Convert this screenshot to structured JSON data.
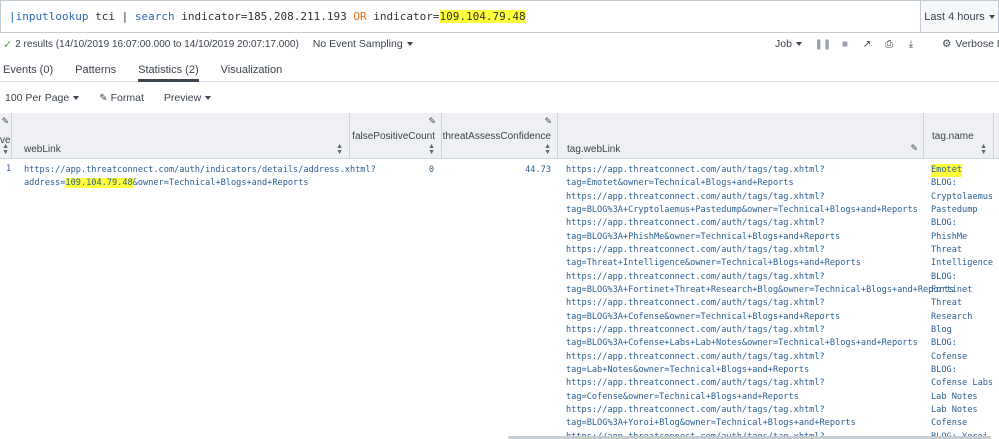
{
  "search": {
    "pipe": "|",
    "cmd1": "inputlookup",
    "arg1": " tci | ",
    "cmd2": "search",
    "arg2": " indicator=185.208.211.193 ",
    "op": "OR",
    "arg3": " indicator=",
    "highlight": "109.104.79.48",
    "time_range": "Last 4 hours"
  },
  "status": {
    "check": "✓",
    "results": "2 results (14/10/2019 16:07:00.000 to 14/10/2019 20:07:17.000)",
    "sampling": "No Event Sampling",
    "job": "Job",
    "verbose": "Verbose Mo"
  },
  "tabs": [
    {
      "label": "Events (0)"
    },
    {
      "label": "Patterns"
    },
    {
      "label": "Statistics (2)"
    },
    {
      "label": "Visualization"
    }
  ],
  "toolbar": {
    "per_page": "100 Per Page",
    "format": "Format",
    "preview": "Preview"
  },
  "columns": {
    "col0": "ve",
    "weblink": "webLink",
    "fpc": "falsePositiveCount",
    "tac": "threatAssessConfidence",
    "tagweblink": "tag.webLink",
    "tagname": "tag.name"
  },
  "row": {
    "num": "1",
    "weblink_line1": "https://app.threatconnect.com/auth/indicators/details/address.xhtml?",
    "weblink_pre": "address=",
    "weblink_hl": "109.104.79.48",
    "weblink_post": "&owner=Technical+Blogs+and+Reports",
    "fpc": "0",
    "tac": "44.73",
    "tag_links": [
      "https://app.threatconnect.com/auth/tags/tag.xhtml?",
      "tag=Emotet&owner=Technical+Blogs+and+Reports",
      "https://app.threatconnect.com/auth/tags/tag.xhtml?",
      "tag=BLOG%3A+Cryptolaemus+Pastedump&owner=Technical+Blogs+and+Reports",
      "https://app.threatconnect.com/auth/tags/tag.xhtml?",
      "tag=BLOG%3A+PhishMe&owner=Technical+Blogs+and+Reports",
      "https://app.threatconnect.com/auth/tags/tag.xhtml?",
      "tag=Threat+Intelligence&owner=Technical+Blogs+and+Reports",
      "https://app.threatconnect.com/auth/tags/tag.xhtml?",
      "tag=BLOG%3A+Fortinet+Threat+Research+Blog&owner=Technical+Blogs+and+Reports",
      "https://app.threatconnect.com/auth/tags/tag.xhtml?",
      "tag=BLOG%3A+Cofense&owner=Technical+Blogs+and+Reports",
      "https://app.threatconnect.com/auth/tags/tag.xhtml?",
      "tag=BLOG%3A+Cofense+Labs+Lab+Notes&owner=Technical+Blogs+and+Reports",
      "https://app.threatconnect.com/auth/tags/tag.xhtml?",
      "tag=Lab+Notes&owner=Technical+Blogs+and+Reports",
      "https://app.threatconnect.com/auth/tags/tag.xhtml?",
      "tag=Cofense&owner=Technical+Blogs+and+Reports",
      "https://app.threatconnect.com/auth/tags/tag.xhtml?",
      "tag=BLOG%3A+Yoroi+Blog&owner=Technical+Blogs+and+Reports",
      "https://app.threatconnect.com/auth/tags/tag.xhtml?"
    ],
    "tag_names": [
      "Emotet",
      "BLOG:",
      "Cryptolaemus",
      "Pastedump",
      "BLOG:",
      "PhishMe",
      "Threat",
      "Intelligence",
      "BLOG:",
      "Fortinet",
      "Threat",
      "Research",
      "Blog",
      "BLOG:",
      "Cofense",
      "BLOG:",
      "Cofense Labs",
      "Lab Notes",
      "Lab Notes",
      "Cofense",
      "BLOG: Yoroi"
    ]
  },
  "colors": {
    "highlight": "#ffff3b",
    "link": "#2b5e94",
    "keyword": "#2b69b6",
    "operator": "#e8701b"
  }
}
